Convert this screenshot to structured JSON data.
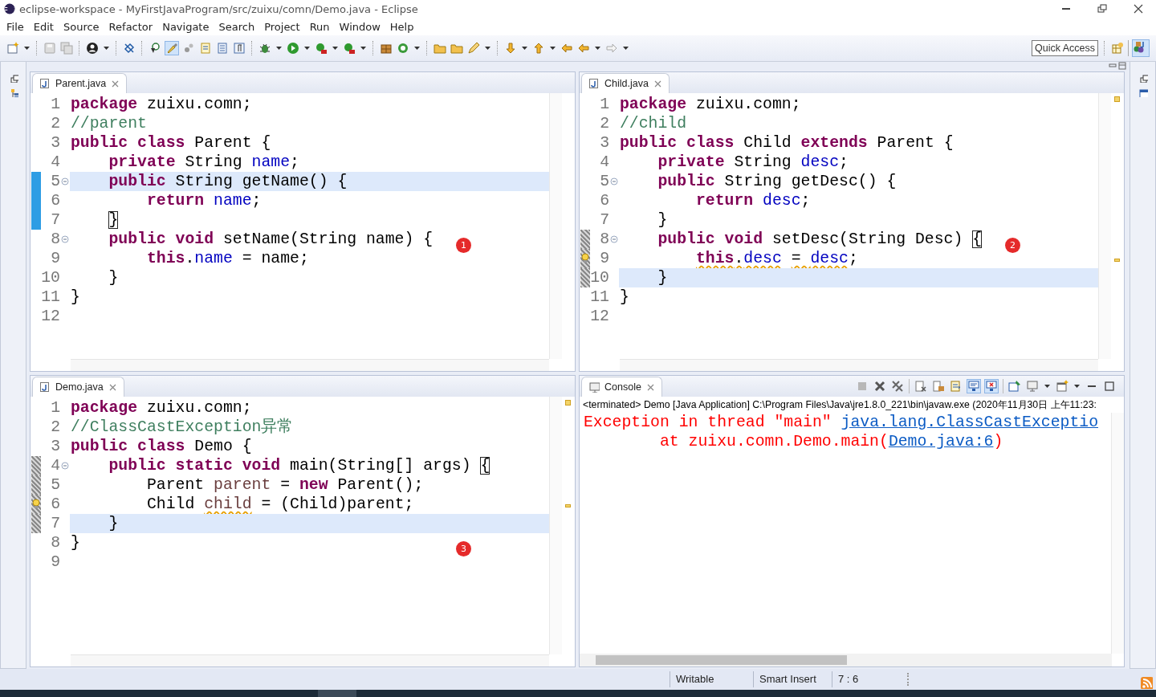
{
  "window": {
    "title": "eclipse-workspace - MyFirstJavaProgram/src/zuixu/comn/Demo.java - Eclipse"
  },
  "menu": [
    "File",
    "Edit",
    "Source",
    "Refactor",
    "Navigate",
    "Search",
    "Project",
    "Run",
    "Window",
    "Help"
  ],
  "toolbar": {
    "toggle_on": true,
    "quick_access": "Quick Access"
  },
  "editors": [
    {
      "tab": "Parent.java",
      "badge": "1",
      "lines": [
        {
          "n": "1",
          "current": false,
          "fold": false,
          "changed": false,
          "in_range": false,
          "warning": false,
          "tokens": [
            {
              "text": "package",
              "kind": "keyword"
            },
            {
              "text": " zuixu.comn;",
              "kind": "plain"
            }
          ]
        },
        {
          "n": "2",
          "current": false,
          "fold": false,
          "changed": false,
          "in_range": false,
          "warning": false,
          "tokens": [
            {
              "text": "//parent",
              "kind": "comment"
            }
          ]
        },
        {
          "n": "3",
          "current": false,
          "fold": false,
          "changed": false,
          "in_range": false,
          "warning": false,
          "tokens": [
            {
              "text": "public class",
              "kind": "keyword"
            },
            {
              "text": " Parent {",
              "kind": "plain"
            }
          ]
        },
        {
          "n": "4",
          "current": false,
          "fold": false,
          "changed": false,
          "in_range": false,
          "warning": false,
          "tokens": [
            {
              "text": "    private",
              "kind": "keyword"
            },
            {
              "text": " String ",
              "kind": "plain"
            },
            {
              "text": "name",
              "kind": "field"
            },
            {
              "text": ";",
              "kind": "plain"
            }
          ]
        },
        {
          "n": "5",
          "current": true,
          "fold": true,
          "changed": true,
          "in_range": false,
          "warning": false,
          "tokens": [
            {
              "text": "    public",
              "kind": "keyword"
            },
            {
              "text": " String getName() {",
              "kind": "plain"
            }
          ]
        },
        {
          "n": "6",
          "current": false,
          "fold": false,
          "changed": true,
          "in_range": false,
          "warning": false,
          "tokens": [
            {
              "text": "        return",
              "kind": "keyword"
            },
            {
              "text": " name",
              "kind": "field"
            },
            {
              "text": ";",
              "kind": "plain"
            }
          ]
        },
        {
          "n": "7",
          "current": false,
          "fold": false,
          "changed": true,
          "in_range": false,
          "warning": false,
          "tokens": [
            {
              "text": "    }",
              "kind": "plain",
              "bracket": true
            }
          ]
        },
        {
          "n": "8",
          "current": false,
          "fold": true,
          "changed": false,
          "in_range": false,
          "warning": false,
          "tokens": [
            {
              "text": "    public void",
              "kind": "keyword"
            },
            {
              "text": " setName(String name) {",
              "kind": "plain"
            }
          ]
        },
        {
          "n": "9",
          "current": false,
          "fold": false,
          "changed": false,
          "in_range": false,
          "warning": false,
          "tokens": [
            {
              "text": "        this",
              "kind": "keyword"
            },
            {
              "text": ".",
              "kind": "plain"
            },
            {
              "text": "name",
              "kind": "field"
            },
            {
              "text": " = name;",
              "kind": "plain"
            }
          ]
        },
        {
          "n": "10",
          "current": false,
          "fold": false,
          "changed": false,
          "in_range": false,
          "warning": false,
          "tokens": [
            {
              "text": "    }",
              "kind": "plain"
            }
          ]
        },
        {
          "n": "11",
          "current": false,
          "fold": false,
          "changed": false,
          "in_range": false,
          "warning": false,
          "tokens": [
            {
              "text": "}",
              "kind": "plain"
            }
          ]
        },
        {
          "n": "12",
          "current": false,
          "fold": false,
          "changed": false,
          "in_range": false,
          "warning": false
        }
      ]
    },
    {
      "tab": "Child.java",
      "badge": "2",
      "lines": [
        {
          "n": "1",
          "current": false,
          "fold": false,
          "changed": false,
          "in_range": false,
          "warning": false,
          "tokens": [
            {
              "text": "package",
              "kind": "keyword"
            },
            {
              "text": " zuixu.comn;",
              "kind": "plain"
            }
          ]
        },
        {
          "n": "2",
          "current": false,
          "fold": false,
          "changed": false,
          "in_range": false,
          "warning": false,
          "tokens": [
            {
              "text": "//child",
              "kind": "comment"
            }
          ]
        },
        {
          "n": "3",
          "current": false,
          "fold": false,
          "changed": false,
          "in_range": false,
          "warning": false,
          "tokens": [
            {
              "text": "public class",
              "kind": "keyword"
            },
            {
              "text": " Child ",
              "kind": "plain"
            },
            {
              "text": "extends",
              "kind": "keyword"
            },
            {
              "text": " Parent {",
              "kind": "plain"
            }
          ]
        },
        {
          "n": "4",
          "current": false,
          "fold": false,
          "changed": false,
          "in_range": false,
          "warning": false,
          "tokens": [
            {
              "text": "    private",
              "kind": "keyword"
            },
            {
              "text": " String ",
              "kind": "plain"
            },
            {
              "text": "desc",
              "kind": "field"
            },
            {
              "text": ";",
              "kind": "plain"
            }
          ]
        },
        {
          "n": "5",
          "current": false,
          "fold": true,
          "changed": false,
          "in_range": false,
          "warning": false,
          "tokens": [
            {
              "text": "    public",
              "kind": "keyword"
            },
            {
              "text": " String getDesc() {",
              "kind": "plain"
            }
          ]
        },
        {
          "n": "6",
          "current": false,
          "fold": false,
          "changed": false,
          "in_range": false,
          "warning": false,
          "tokens": [
            {
              "text": "        return",
              "kind": "keyword"
            },
            {
              "text": " desc",
              "kind": "field"
            },
            {
              "text": ";",
              "kind": "plain"
            }
          ]
        },
        {
          "n": "7",
          "current": false,
          "fold": false,
          "changed": false,
          "in_range": false,
          "warning": false,
          "tokens": [
            {
              "text": "    }",
              "kind": "plain"
            }
          ]
        },
        {
          "n": "8",
          "current": false,
          "fold": true,
          "changed": false,
          "in_range": true,
          "warning": false,
          "tokens": [
            {
              "text": "    public void",
              "kind": "keyword",
              "bracket": false
            },
            {
              "text": " setDesc(String Desc) ",
              "kind": "plain",
              "bracket": false
            },
            {
              "text": "{",
              "kind": "plain",
              "bracket": true
            }
          ]
        },
        {
          "n": "9",
          "current": false,
          "fold": false,
          "changed": false,
          "in_range": true,
          "warning": true,
          "tokens": [
            {
              "text": "        this",
              "kind": "keyword",
              "warn": true
            },
            {
              "text": ".",
              "kind": "plain",
              "warn": true
            },
            {
              "text": "desc",
              "kind": "field",
              "warn": true
            },
            {
              "text": " = ",
              "kind": "plain",
              "warn": true
            },
            {
              "text": "desc",
              "kind": "field",
              "warn": true
            },
            {
              "text": ";",
              "kind": "plain",
              "warn": false
            }
          ]
        },
        {
          "n": "10",
          "current": true,
          "fold": false,
          "changed": false,
          "in_range": true,
          "warning": false,
          "tokens": [
            {
              "text": "    }",
              "kind": "plain"
            }
          ]
        },
        {
          "n": "11",
          "current": false,
          "fold": false,
          "changed": false,
          "in_range": false,
          "warning": false,
          "tokens": [
            {
              "text": "}",
              "kind": "plain"
            }
          ]
        },
        {
          "n": "12",
          "current": false,
          "fold": false,
          "changed": false,
          "in_range": false,
          "warning": false
        }
      ]
    },
    {
      "tab": "Demo.java",
      "badge": "3",
      "lines": [
        {
          "n": "1",
          "current": false,
          "fold": false,
          "changed": false,
          "in_range": false,
          "warning": false,
          "tokens": [
            {
              "text": "package",
              "kind": "keyword"
            },
            {
              "text": " zuixu.comn;",
              "kind": "plain"
            }
          ]
        },
        {
          "n": "2",
          "current": false,
          "fold": false,
          "changed": false,
          "in_range": false,
          "warning": false,
          "tokens": [
            {
              "text": "//ClassCastException异常",
              "kind": "comment"
            }
          ]
        },
        {
          "n": "3",
          "current": false,
          "fold": false,
          "changed": false,
          "in_range": false,
          "warning": false,
          "tokens": [
            {
              "text": "public class",
              "kind": "keyword"
            },
            {
              "text": " Demo {",
              "kind": "plain"
            }
          ]
        },
        {
          "n": "4",
          "current": false,
          "fold": true,
          "changed": false,
          "in_range": true,
          "warning": false,
          "tokens": [
            {
              "text": "    public static void",
              "kind": "keyword",
              "bracket": false
            },
            {
              "text": " main(String[] args) ",
              "kind": "plain",
              "bracket": false
            },
            {
              "text": "{",
              "kind": "plain",
              "bracket": true
            }
          ]
        },
        {
          "n": "5",
          "current": false,
          "fold": false,
          "changed": false,
          "in_range": true,
          "warning": false,
          "tokens": [
            {
              "text": "        Parent ",
              "kind": "plain"
            },
            {
              "text": "parent",
              "kind": "local"
            },
            {
              "text": " = ",
              "kind": "plain"
            },
            {
              "text": "new",
              "kind": "keyword"
            },
            {
              "text": " Parent();",
              "kind": "plain"
            }
          ]
        },
        {
          "n": "6",
          "current": false,
          "fold": false,
          "changed": false,
          "in_range": true,
          "warning": true,
          "tokens": [
            {
              "text": "        Child ",
              "kind": "plain",
              "warn": false
            },
            {
              "text": "child",
              "kind": "local",
              "warn": true
            },
            {
              "text": " = (Child)parent;",
              "kind": "plain",
              "warn": false
            }
          ]
        },
        {
          "n": "7",
          "current": true,
          "fold": false,
          "changed": false,
          "in_range": true,
          "warning": false,
          "tokens": [
            {
              "text": "    }",
              "kind": "plain"
            }
          ]
        },
        {
          "n": "8",
          "current": false,
          "fold": false,
          "changed": false,
          "in_range": false,
          "warning": false,
          "tokens": [
            {
              "text": "}",
              "kind": "plain"
            }
          ]
        },
        {
          "n": "9",
          "current": false,
          "fold": false,
          "changed": false,
          "in_range": false,
          "warning": false
        }
      ]
    }
  ],
  "console": {
    "tab": "Console",
    "toggles": [
      {
        "on": true
      },
      {
        "on": true
      }
    ],
    "header": "<terminated> Demo [Java Application] C:\\Program Files\\Java\\jre1.8.0_221\\bin\\javaw.exe (2020年11月30日 上午11:23:",
    "lines": [
      [
        {
          "text": "Exception in thread \"main\" ",
          "kind": "error"
        },
        {
          "text": "java.lang.ClassCastExceptio",
          "kind": "link"
        }
      ],
      [
        {
          "text": "\tat zuixu.comn.Demo.main(",
          "kind": "error"
        },
        {
          "text": "Demo.java:6",
          "kind": "link"
        },
        {
          "text": ")",
          "kind": "error"
        }
      ]
    ]
  },
  "status_bar": [
    "Writable",
    "Smart Insert",
    "7 : 6"
  ]
}
